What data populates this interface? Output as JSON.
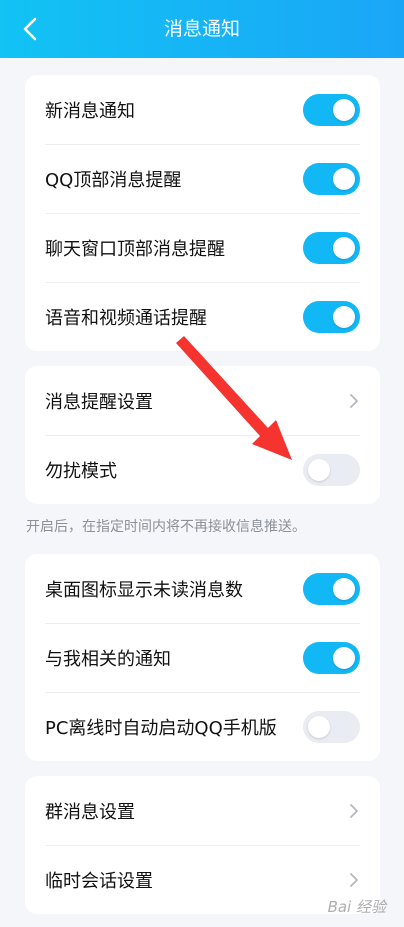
{
  "header": {
    "title": "消息通知",
    "back_icon": "chevron-left-icon"
  },
  "group1": [
    {
      "label": "新消息通知",
      "on": true
    },
    {
      "label": "QQ顶部消息提醒",
      "on": true
    },
    {
      "label": "聊天窗口顶部消息提醒",
      "on": true
    },
    {
      "label": "语音和视频通话提醒",
      "on": true
    }
  ],
  "group2": {
    "reminder_settings": "消息提醒设置",
    "dnd": {
      "label": "勿扰模式",
      "on": false
    }
  },
  "hint": "开启后，在指定时间内将不再接收信息推送。",
  "group3": [
    {
      "label": "桌面图标显示未读消息数",
      "on": true
    },
    {
      "label": "与我相关的通知",
      "on": true
    },
    {
      "label": "PC离线时自动启动QQ手机版",
      "on": false
    }
  ],
  "group4": {
    "group_msg": "群消息设置",
    "temp_chat": "临时会话设置"
  },
  "watermark": "Bai 经验",
  "colors": {
    "accent": "#12b7f5",
    "toggle_off": "#e9ecf2",
    "arrow": "#f5332f"
  }
}
